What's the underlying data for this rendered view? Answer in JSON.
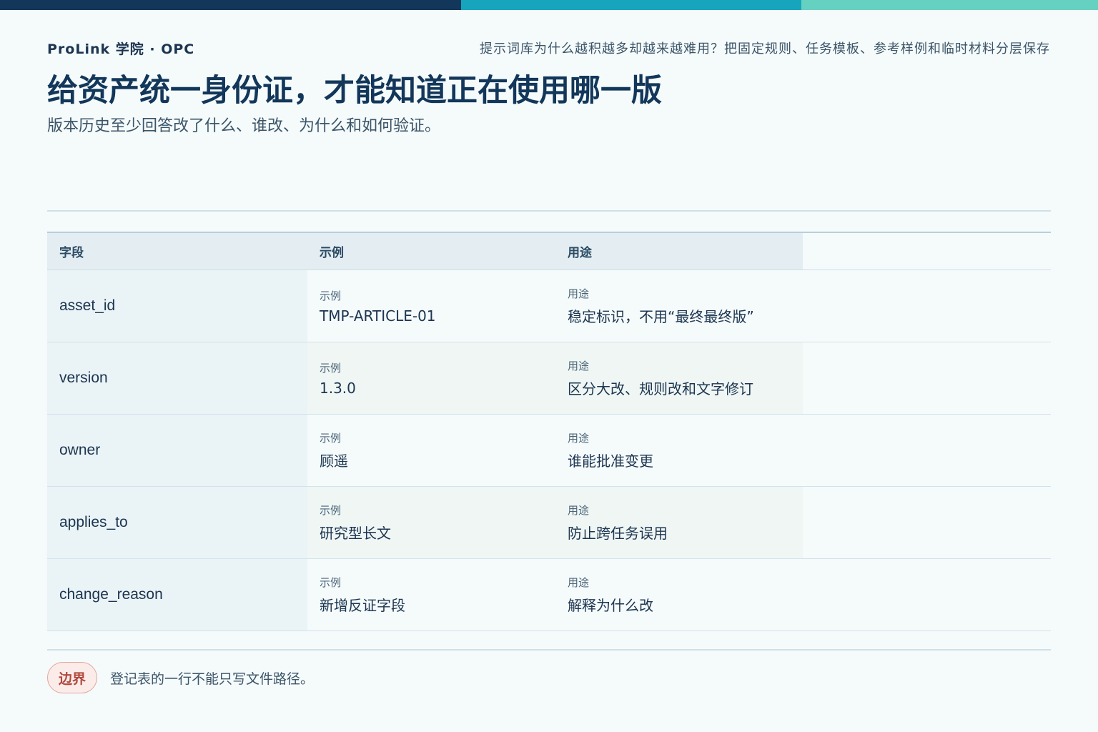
{
  "header": {
    "brand": "ProLink 学院 · OPC",
    "note": "提示词库为什么越积越多却越来越难用？把固定规则、任务模板、参考样例和临时材料分层保存"
  },
  "title": "给资产统一身份证，才能知道正在使用哪一版",
  "subtitle": "版本历史至少回答改了什么、谁改、为什么和如何验证。",
  "table": {
    "headers": [
      "字段",
      "示例",
      "用途"
    ],
    "rows": [
      {
        "field": "asset_id",
        "example_label": "示例",
        "example": "TMP-ARTICLE-01",
        "use_label": "用途",
        "use": "稳定标识，不用“最终最终版”"
      },
      {
        "field": "version",
        "example_label": "示例",
        "example": "1.3.0",
        "use_label": "用途",
        "use": "区分大改、规则改和文字修订"
      },
      {
        "field": "owner",
        "example_label": "示例",
        "example": "顾遥",
        "use_label": "用途",
        "use": "谁能批准变更"
      },
      {
        "field": "applies_to",
        "example_label": "示例",
        "example": "研究型长文",
        "use_label": "用途",
        "use": "防止跨任务误用"
      },
      {
        "field": "change_reason",
        "example_label": "示例",
        "example": "新增反证字段",
        "use_label": "用途",
        "use": "解释为什么改"
      }
    ]
  },
  "footer": {
    "badge": "边界",
    "note": "登记表的一行不能只写文件路径。"
  },
  "colors": {
    "navy": "#12375a",
    "teal": "#17a5bd",
    "mint": "#65d1c1",
    "badge_red": "#b04a3d"
  }
}
